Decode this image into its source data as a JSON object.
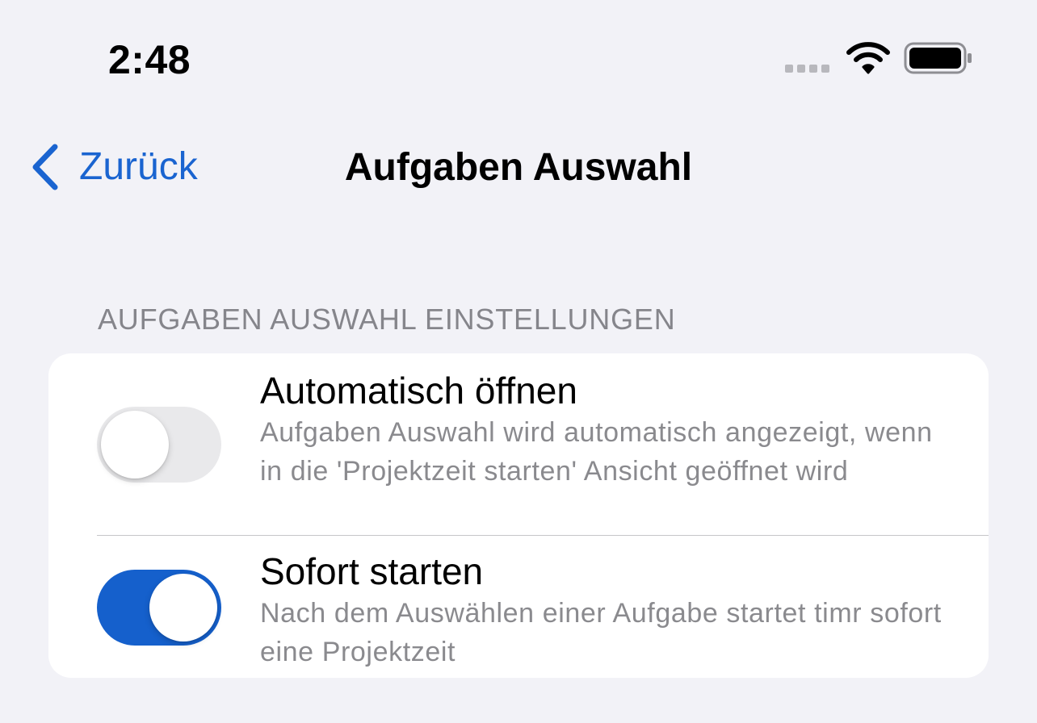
{
  "status_bar": {
    "time": "2:48",
    "icons": [
      "cellular-signal-icon",
      "wifi-icon",
      "battery-icon"
    ]
  },
  "nav": {
    "back_label": "Zurück",
    "title": "Aufgaben Auswahl"
  },
  "section": {
    "header": "AUFGABEN AUSWAHL EINSTELLUNGEN"
  },
  "settings": [
    {
      "title": "Automatisch öffnen",
      "description": "Aufgaben Auswahl wird automatisch angezeigt, wenn in die 'Projektzeit starten' Ansicht geöffnet wird",
      "enabled": false
    },
    {
      "title": "Sofort starten",
      "description": "Nach dem Auswählen einer Aufgabe startet timr sofort eine Projektzeit",
      "enabled": true
    }
  ],
  "colors": {
    "accent": "#1560cc",
    "background": "#f2f2f7",
    "secondary_text": "#8a8a8e",
    "toggle_off": "#e9e9eb"
  }
}
